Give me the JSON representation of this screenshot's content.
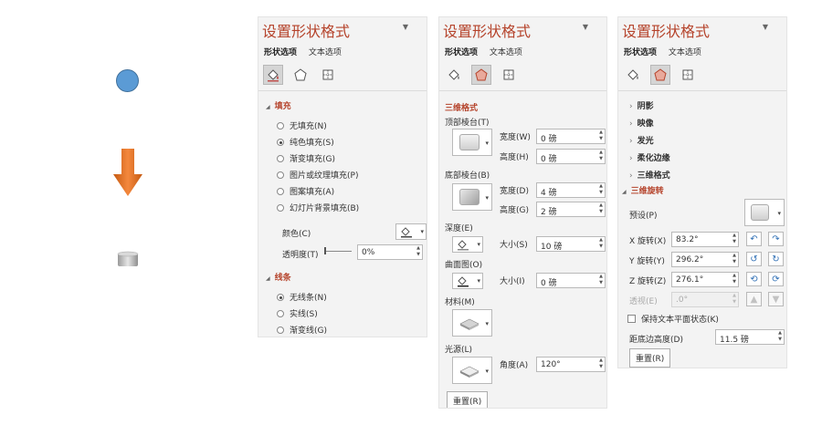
{
  "panel_title": "设置形状格式",
  "tabs": {
    "shape": "形状选项",
    "text": "文本选项"
  },
  "panel1": {
    "fill_section": "填充",
    "fill_options": [
      "无填充(N)",
      "纯色填充(S)",
      "渐变填充(G)",
      "图片或纹理填充(P)",
      "图案填充(A)",
      "幻灯片背景填充(B)"
    ],
    "fill_selected_index": 1,
    "color_label": "颜色(C)",
    "transparency_label": "透明度(T)",
    "transparency_value": "0%",
    "line_section": "线条",
    "line_options": [
      "无线条(N)",
      "实线(S)",
      "渐变线(G)"
    ],
    "line_selected_index": 0
  },
  "panel2": {
    "section": "三维格式",
    "top_bevel": "顶部棱台(T)",
    "width_label": "宽度(W)",
    "top_width": "0 磅",
    "height_label": "高度(H)",
    "top_height": "0 磅",
    "bottom_bevel": "底部棱台(B)",
    "width_label_b": "宽度(D)",
    "bottom_width": "4 磅",
    "height_label_b": "高度(G)",
    "bottom_height": "2 磅",
    "depth": "深度(E)",
    "size_label": "大小(S)",
    "depth_size": "10 磅",
    "contour": "曲面图(O)",
    "size_label_c": "大小(I)",
    "contour_size": "0 磅",
    "material": "材料(M)",
    "lighting": "光源(L)",
    "angle_label": "角度(A)",
    "angle_value": "120°",
    "reset": "重置(R)"
  },
  "panel3": {
    "items": [
      "阴影",
      "映像",
      "发光",
      "柔化边缘",
      "三维格式"
    ],
    "section": "三维旋转",
    "preset": "预设(P)",
    "x_label": "X 旋转(X)",
    "x_value": "83.2°",
    "y_label": "Y 旋转(Y)",
    "y_value": "296.2°",
    "z_label": "Z 旋转(Z)",
    "z_value": "276.1°",
    "perspective_label": "透视(E)",
    "perspective_value": ".0°",
    "keep_flat": "保持文本平面状态(K)",
    "distance_label": "距底边高度(D)",
    "distance_value": "11.5 磅",
    "reset": "重置(R)"
  },
  "colors": {
    "accent": "#b5432b",
    "circle": "#5b9bd5",
    "arrow": "#ed7d31",
    "cylinder": "#bfbfbf"
  }
}
